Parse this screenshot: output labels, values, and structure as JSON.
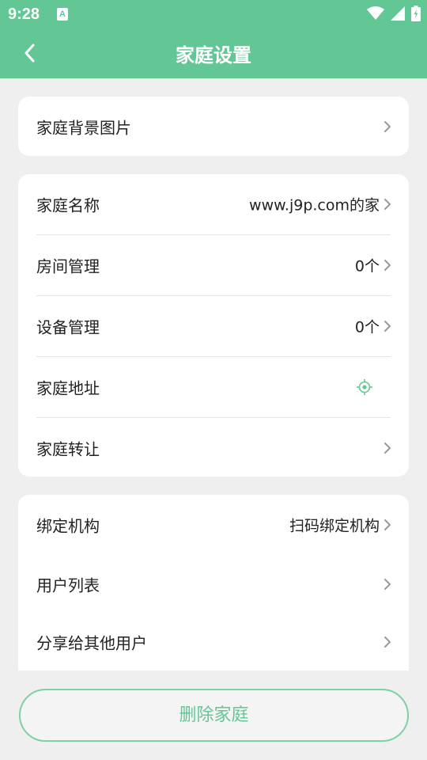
{
  "status": {
    "time": "9:28",
    "notif_glyph": "A"
  },
  "appbar": {
    "title": "家庭设置"
  },
  "cards": {
    "background": {
      "label": "家庭背景图片"
    },
    "info": {
      "name": {
        "label": "家庭名称",
        "value": "www.j9p.com的家"
      },
      "rooms": {
        "label": "房间管理",
        "value": "0个"
      },
      "devices": {
        "label": "设备管理",
        "value": "0个"
      },
      "address": {
        "label": "家庭地址"
      },
      "transfer": {
        "label": "家庭转让"
      }
    },
    "members": {
      "org": {
        "label": "绑定机构",
        "value": "扫码绑定机构"
      },
      "users": {
        "label": "用户列表"
      },
      "share": {
        "label": "分享给其他用户"
      }
    }
  },
  "delete_button": {
    "label": "删除家庭"
  },
  "colors": {
    "accent": "#63c795",
    "background": "#efefef",
    "card": "#ffffff"
  }
}
